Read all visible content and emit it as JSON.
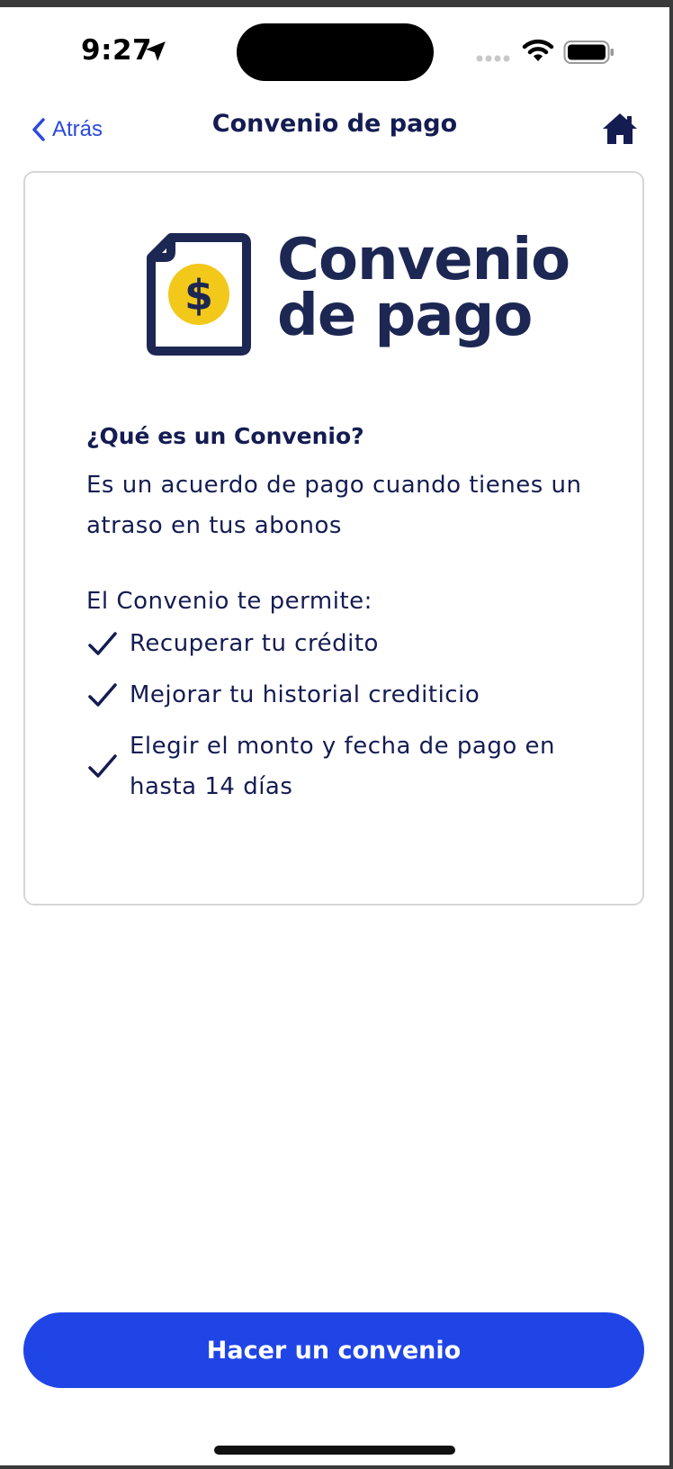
{
  "status_bar": {
    "time": "9:27",
    "icons": [
      "location-arrow-icon",
      "signal-icon",
      "wifi-icon",
      "battery-icon"
    ]
  },
  "nav": {
    "back_label": "Atrás",
    "title": "Convenio de pago",
    "home_icon": "home-icon"
  },
  "card": {
    "logo": {
      "icon": "document-dollar-icon",
      "line1": "Convenio",
      "line2": "de pago"
    },
    "question": "¿Qué es un Convenio?",
    "description": "Es un acuerdo de pago cuando tienes un atraso en tus abonos",
    "benefits_intro": "El Convenio te permite:",
    "benefits": [
      "Recuperar tu crédito",
      "Mejorar tu historial crediticio",
      "Elegir el monto y fecha de pago en hasta 14 días"
    ]
  },
  "cta": {
    "label": "Hacer un convenio"
  },
  "colors": {
    "primary": "#2045e6",
    "navy": "#141c52",
    "accent_yellow": "#f2c81b",
    "link": "#2b49dc"
  }
}
